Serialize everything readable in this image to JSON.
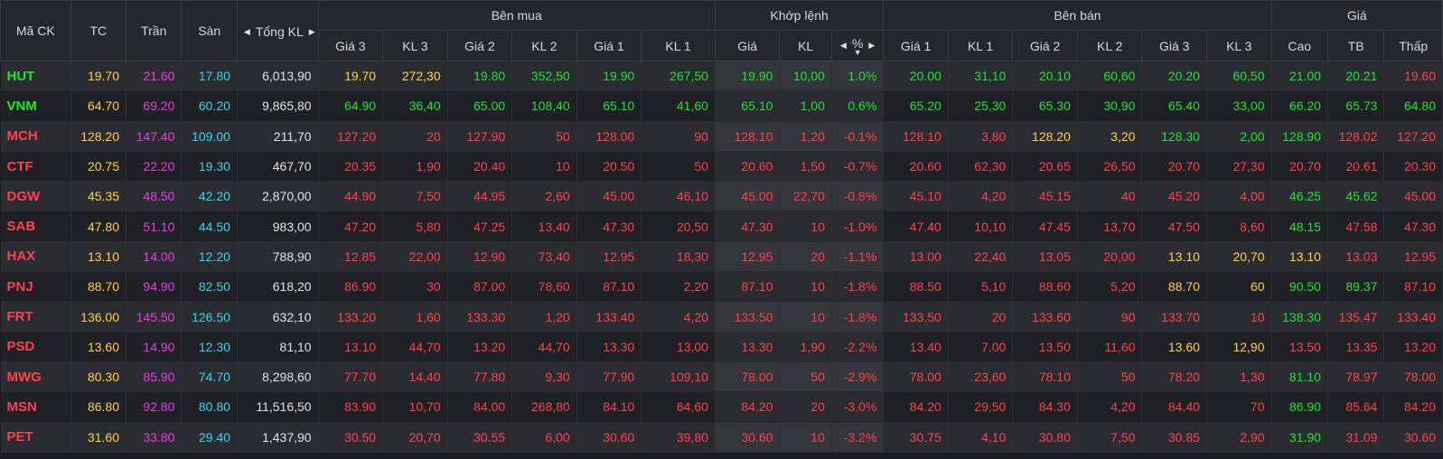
{
  "headers": {
    "symbol": "Mã CK",
    "ref": "TC",
    "ceiling": "Trần",
    "floor": "Sàn",
    "total_vol": "Tổng KL",
    "buy_group": "Bên mua",
    "match_group": "Khớp lệnh",
    "sell_group": "Bên bán",
    "price_group": "Giá",
    "buy_cols": [
      "Giá 3",
      "KL 3",
      "Giá 2",
      "KL 2",
      "Giá 1",
      "KL 1"
    ],
    "match_cols": [
      "Giá",
      "KL",
      "%"
    ],
    "sell_cols": [
      "Giá 1",
      "KL 1",
      "Giá 2",
      "KL 2",
      "Giá 3",
      "KL 3"
    ],
    "price_cols": [
      "Cao",
      "TB",
      "Thấp"
    ]
  },
  "colors": {
    "up": "#19e62e",
    "down": "#ff3f4f",
    "ref": "#ffd23b",
    "ceiling": "#e93ae6",
    "floor": "#2cd9ee",
    "neutral": "#e2e2e2"
  },
  "rows": [
    {
      "sym": "HUT",
      "symc": "grn",
      "tc": "19.70",
      "tran": "21.60",
      "san": "17.80",
      "tkl": "6,013,90",
      "cells": [
        [
          "19.70",
          "yel"
        ],
        [
          "272,30",
          "yel"
        ],
        [
          "19.80",
          "grn"
        ],
        [
          "352,50",
          "grn"
        ],
        [
          "19.90",
          "grn"
        ],
        [
          "267,50",
          "grn"
        ],
        [
          "19.90",
          "grn"
        ],
        [
          "10,00",
          "grn"
        ],
        [
          "1.0%",
          "grn"
        ],
        [
          "20.00",
          "grn"
        ],
        [
          "31,10",
          "grn"
        ],
        [
          "20.10",
          "grn"
        ],
        [
          "60,60",
          "grn"
        ],
        [
          "20.20",
          "grn"
        ],
        [
          "60,50",
          "grn"
        ],
        [
          "21.00",
          "grn"
        ],
        [
          "20.21",
          "grn"
        ],
        [
          "19.60",
          "red"
        ]
      ]
    },
    {
      "sym": "VNM",
      "symc": "grn",
      "tc": "64.70",
      "tran": "69.20",
      "san": "60.20",
      "tkl": "9,865,80",
      "cells": [
        [
          "64.90",
          "grn"
        ],
        [
          "36,40",
          "grn"
        ],
        [
          "65.00",
          "grn"
        ],
        [
          "108,40",
          "grn"
        ],
        [
          "65.10",
          "grn"
        ],
        [
          "41,60",
          "grn"
        ],
        [
          "65.10",
          "grn"
        ],
        [
          "1,00",
          "grn"
        ],
        [
          "0.6%",
          "grn"
        ],
        [
          "65.20",
          "grn"
        ],
        [
          "25,30",
          "grn"
        ],
        [
          "65.30",
          "grn"
        ],
        [
          "30,90",
          "grn"
        ],
        [
          "65.40",
          "grn"
        ],
        [
          "33,00",
          "grn"
        ],
        [
          "66.20",
          "grn"
        ],
        [
          "65.73",
          "grn"
        ],
        [
          "64.80",
          "grn"
        ]
      ]
    },
    {
      "sym": "MCH",
      "symc": "red",
      "tc": "128.20",
      "tran": "147.40",
      "san": "109.00",
      "tkl": "211,70",
      "cells": [
        [
          "127.20",
          "red"
        ],
        [
          "20",
          "red"
        ],
        [
          "127.90",
          "red"
        ],
        [
          "50",
          "red"
        ],
        [
          "128.00",
          "red"
        ],
        [
          "90",
          "red"
        ],
        [
          "128.10",
          "red"
        ],
        [
          "1,20",
          "red"
        ],
        [
          "-0.1%",
          "red"
        ],
        [
          "128.10",
          "red"
        ],
        [
          "3,80",
          "red"
        ],
        [
          "128.20",
          "yel"
        ],
        [
          "3,20",
          "yel"
        ],
        [
          "128.30",
          "grn"
        ],
        [
          "2,00",
          "grn"
        ],
        [
          "128.90",
          "grn"
        ],
        [
          "128.02",
          "red"
        ],
        [
          "127.20",
          "red"
        ]
      ]
    },
    {
      "sym": "CTF",
      "symc": "red",
      "tc": "20.75",
      "tran": "22.20",
      "san": "19.30",
      "tkl": "467,70",
      "cells": [
        [
          "20.35",
          "red"
        ],
        [
          "1,90",
          "red"
        ],
        [
          "20.40",
          "red"
        ],
        [
          "10",
          "red"
        ],
        [
          "20.50",
          "red"
        ],
        [
          "50",
          "red"
        ],
        [
          "20.60",
          "red"
        ],
        [
          "1,50",
          "red"
        ],
        [
          "-0.7%",
          "red"
        ],
        [
          "20.60",
          "red"
        ],
        [
          "62,30",
          "red"
        ],
        [
          "20.65",
          "red"
        ],
        [
          "26,50",
          "red"
        ],
        [
          "20.70",
          "red"
        ],
        [
          "27,30",
          "red"
        ],
        [
          "20.70",
          "red"
        ],
        [
          "20.61",
          "red"
        ],
        [
          "20.30",
          "red"
        ]
      ]
    },
    {
      "sym": "DGW",
      "symc": "red",
      "tc": "45.35",
      "tran": "48.50",
      "san": "42.20",
      "tkl": "2,870,00",
      "cells": [
        [
          "44.90",
          "red"
        ],
        [
          "7,50",
          "red"
        ],
        [
          "44.95",
          "red"
        ],
        [
          "2,60",
          "red"
        ],
        [
          "45.00",
          "red"
        ],
        [
          "46,10",
          "red"
        ],
        [
          "45.00",
          "red"
        ],
        [
          "22,70",
          "red"
        ],
        [
          "-0.8%",
          "red"
        ],
        [
          "45.10",
          "red"
        ],
        [
          "4,20",
          "red"
        ],
        [
          "45.15",
          "red"
        ],
        [
          "40",
          "red"
        ],
        [
          "45.20",
          "red"
        ],
        [
          "4,00",
          "red"
        ],
        [
          "46.25",
          "grn"
        ],
        [
          "45.62",
          "grn"
        ],
        [
          "45.00",
          "red"
        ]
      ]
    },
    {
      "sym": "SAB",
      "symc": "red",
      "tc": "47.80",
      "tran": "51.10",
      "san": "44.50",
      "tkl": "983,00",
      "cells": [
        [
          "47.20",
          "red"
        ],
        [
          "5,80",
          "red"
        ],
        [
          "47.25",
          "red"
        ],
        [
          "13,40",
          "red"
        ],
        [
          "47.30",
          "red"
        ],
        [
          "20,50",
          "red"
        ],
        [
          "47.30",
          "red"
        ],
        [
          "10",
          "red"
        ],
        [
          "-1.0%",
          "red"
        ],
        [
          "47.40",
          "red"
        ],
        [
          "10,10",
          "red"
        ],
        [
          "47.45",
          "red"
        ],
        [
          "13,70",
          "red"
        ],
        [
          "47.50",
          "red"
        ],
        [
          "8,60",
          "red"
        ],
        [
          "48.15",
          "grn"
        ],
        [
          "47.58",
          "red"
        ],
        [
          "47.30",
          "red"
        ]
      ]
    },
    {
      "sym": "HAX",
      "symc": "red",
      "tc": "13.10",
      "tran": "14.00",
      "san": "12.20",
      "tkl": "788,90",
      "cells": [
        [
          "12.85",
          "red"
        ],
        [
          "22,00",
          "red"
        ],
        [
          "12.90",
          "red"
        ],
        [
          "73,40",
          "red"
        ],
        [
          "12.95",
          "red"
        ],
        [
          "18,30",
          "red"
        ],
        [
          "12.95",
          "red"
        ],
        [
          "20",
          "red"
        ],
        [
          "-1.1%",
          "red"
        ],
        [
          "13.00",
          "red"
        ],
        [
          "22,40",
          "red"
        ],
        [
          "13.05",
          "red"
        ],
        [
          "20,00",
          "red"
        ],
        [
          "13.10",
          "yel"
        ],
        [
          "20,70",
          "yel"
        ],
        [
          "13.10",
          "yel"
        ],
        [
          "13.03",
          "red"
        ],
        [
          "12.95",
          "red"
        ]
      ]
    },
    {
      "sym": "PNJ",
      "symc": "red",
      "tc": "88.70",
      "tran": "94.90",
      "san": "82.50",
      "tkl": "618,20",
      "cells": [
        [
          "86.90",
          "red"
        ],
        [
          "30",
          "red"
        ],
        [
          "87.00",
          "red"
        ],
        [
          "78,60",
          "red"
        ],
        [
          "87.10",
          "red"
        ],
        [
          "2,20",
          "red"
        ],
        [
          "87.10",
          "red"
        ],
        [
          "10",
          "red"
        ],
        [
          "-1.8%",
          "red"
        ],
        [
          "88.50",
          "red"
        ],
        [
          "5,10",
          "red"
        ],
        [
          "88.60",
          "red"
        ],
        [
          "5,20",
          "red"
        ],
        [
          "88.70",
          "yel"
        ],
        [
          "60",
          "yel"
        ],
        [
          "90.50",
          "grn"
        ],
        [
          "89.37",
          "grn"
        ],
        [
          "87.10",
          "red"
        ]
      ]
    },
    {
      "sym": "FRT",
      "symc": "red",
      "tc": "136.00",
      "tran": "145.50",
      "san": "126.50",
      "tkl": "632,10",
      "cells": [
        [
          "133.20",
          "red"
        ],
        [
          "1,60",
          "red"
        ],
        [
          "133.30",
          "red"
        ],
        [
          "1,20",
          "red"
        ],
        [
          "133.40",
          "red"
        ],
        [
          "4,20",
          "red"
        ],
        [
          "133.50",
          "red"
        ],
        [
          "10",
          "red"
        ],
        [
          "-1.8%",
          "red"
        ],
        [
          "133.50",
          "red"
        ],
        [
          "20",
          "red"
        ],
        [
          "133.60",
          "red"
        ],
        [
          "90",
          "red"
        ],
        [
          "133.70",
          "red"
        ],
        [
          "10",
          "red"
        ],
        [
          "138.30",
          "grn"
        ],
        [
          "135.47",
          "red"
        ],
        [
          "133.40",
          "red"
        ]
      ]
    },
    {
      "sym": "PSD",
      "symc": "red",
      "tc": "13.60",
      "tran": "14.90",
      "san": "12.30",
      "tkl": "81,10",
      "cells": [
        [
          "13.10",
          "red"
        ],
        [
          "44,70",
          "red"
        ],
        [
          "13.20",
          "red"
        ],
        [
          "44,70",
          "red"
        ],
        [
          "13.30",
          "red"
        ],
        [
          "13,00",
          "red"
        ],
        [
          "13.30",
          "red"
        ],
        [
          "1,90",
          "red"
        ],
        [
          "-2.2%",
          "red"
        ],
        [
          "13.40",
          "red"
        ],
        [
          "7,00",
          "red"
        ],
        [
          "13.50",
          "red"
        ],
        [
          "11,60",
          "red"
        ],
        [
          "13.60",
          "yel"
        ],
        [
          "12,90",
          "yel"
        ],
        [
          "13.50",
          "red"
        ],
        [
          "13.35",
          "red"
        ],
        [
          "13.20",
          "red"
        ]
      ]
    },
    {
      "sym": "MWG",
      "symc": "red",
      "tc": "80.30",
      "tran": "85.90",
      "san": "74.70",
      "tkl": "8,298,60",
      "cells": [
        [
          "77.70",
          "red"
        ],
        [
          "14,40",
          "red"
        ],
        [
          "77.80",
          "red"
        ],
        [
          "9,30",
          "red"
        ],
        [
          "77.90",
          "red"
        ],
        [
          "109,10",
          "red"
        ],
        [
          "78.00",
          "red"
        ],
        [
          "50",
          "red"
        ],
        [
          "-2.9%",
          "red"
        ],
        [
          "78.00",
          "red"
        ],
        [
          "23,60",
          "red"
        ],
        [
          "78.10",
          "red"
        ],
        [
          "50",
          "red"
        ],
        [
          "78.20",
          "red"
        ],
        [
          "1,30",
          "red"
        ],
        [
          "81.10",
          "grn"
        ],
        [
          "78.97",
          "red"
        ],
        [
          "78.00",
          "red"
        ]
      ]
    },
    {
      "sym": "MSN",
      "symc": "red",
      "tc": "86.80",
      "tran": "92.80",
      "san": "80.80",
      "tkl": "11,516,50",
      "cells": [
        [
          "83.90",
          "red"
        ],
        [
          "10,70",
          "red"
        ],
        [
          "84.00",
          "red"
        ],
        [
          "268,80",
          "red"
        ],
        [
          "84.10",
          "red"
        ],
        [
          "64,60",
          "red"
        ],
        [
          "84.20",
          "red"
        ],
        [
          "20",
          "red"
        ],
        [
          "-3.0%",
          "red"
        ],
        [
          "84.20",
          "red"
        ],
        [
          "29,50",
          "red"
        ],
        [
          "84.30",
          "red"
        ],
        [
          "4,20",
          "red"
        ],
        [
          "84.40",
          "red"
        ],
        [
          "70",
          "red"
        ],
        [
          "86.90",
          "grn"
        ],
        [
          "85.64",
          "red"
        ],
        [
          "84.20",
          "red"
        ]
      ]
    },
    {
      "sym": "PET",
      "symc": "red",
      "tc": "31.60",
      "tran": "33.80",
      "san": "29.40",
      "tkl": "1,437,90",
      "cells": [
        [
          "30.50",
          "red"
        ],
        [
          "20,70",
          "red"
        ],
        [
          "30.55",
          "red"
        ],
        [
          "6,00",
          "red"
        ],
        [
          "30.60",
          "red"
        ],
        [
          "39,80",
          "red"
        ],
        [
          "30.60",
          "red"
        ],
        [
          "10",
          "red"
        ],
        [
          "-3.2%",
          "red"
        ],
        [
          "30.75",
          "red"
        ],
        [
          "4,10",
          "red"
        ],
        [
          "30.80",
          "red"
        ],
        [
          "7,50",
          "red"
        ],
        [
          "30.85",
          "red"
        ],
        [
          "2,90",
          "red"
        ],
        [
          "31.90",
          "grn"
        ],
        [
          "31.09",
          "red"
        ],
        [
          "30.60",
          "red"
        ]
      ]
    }
  ]
}
